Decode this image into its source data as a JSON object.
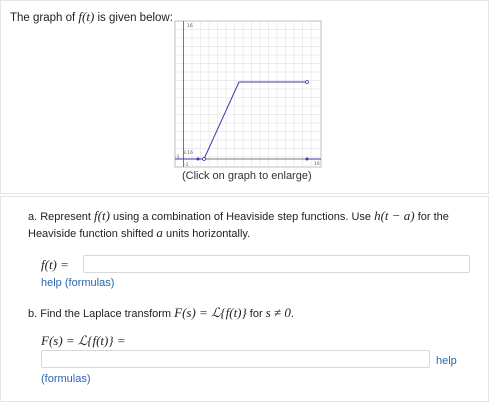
{
  "intro": {
    "prefix": "The graph of ",
    "func": "f(t)",
    "suffix": " is given below:"
  },
  "graph": {
    "enlarge_text": "(Click on graph to enlarge)",
    "ytop_label": "16",
    "ymark_label": "3.16",
    "xleft_label": "-1",
    "xright_label": "16",
    "ybottom_label": "-1",
    "line_color": "#3a3aa8"
  },
  "part_a": {
    "text_1": "a. Represent ",
    "func": "f(t)",
    "text_2": " using a combination of Heaviside step functions. Use ",
    "h": "h(t − a)",
    "text_3": " for the Heaviside function shifted ",
    "a": "a",
    "text_4": " units horizontally.",
    "label": "f(t) =",
    "input_value": "",
    "help": "help (formulas)"
  },
  "part_b": {
    "text_1": "b. Find the Laplace transform ",
    "F": "F(s) = ℒ{f(t)}",
    "text_2": " for ",
    "cond": "s ≠ 0",
    "text_3": ".",
    "label": "F(s) = ℒ{f(t)} =",
    "input_value": "",
    "help": "help",
    "formulas": "(formulas)"
  }
}
